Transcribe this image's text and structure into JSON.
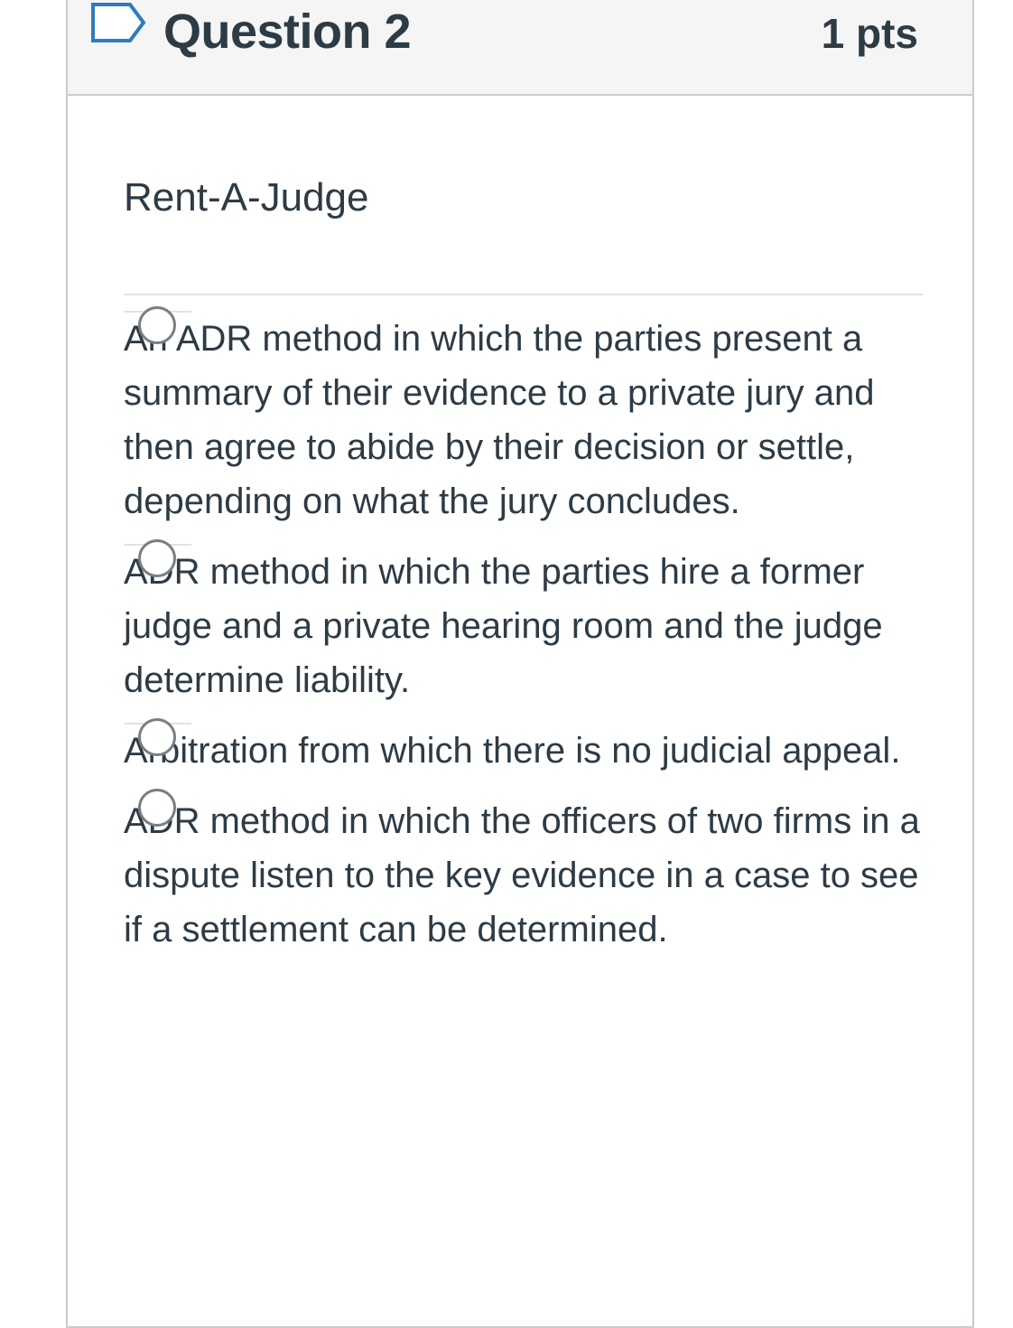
{
  "question": {
    "title": "Question 2",
    "points": "1 pts",
    "prompt": "Rent-A-Judge",
    "flag_icon": "bookmark-flag-icon"
  },
  "answers": [
    {
      "label": "An ADR method in which the parties present a summary of their evidence to a private jury and then agree to abide by their decision or settle, depending on what the jury concludes."
    },
    {
      "label": "ADR method in which the parties hire a former judge and a private hearing room and the judge determine liability."
    },
    {
      "label": "Arbitration from which there is no judicial appeal."
    },
    {
      "label": "ADR method in which the officers of two firms in a dispute listen to the key evidence in a case to see if a settlement can be determined."
    }
  ],
  "colors": {
    "text": "#2d3b45",
    "header_background": "#f5f5f5",
    "border": "#c7cdd1",
    "divider": "#dfe3e6",
    "radio_border": "#777f85",
    "flag_outline": "#2d7bbf"
  }
}
